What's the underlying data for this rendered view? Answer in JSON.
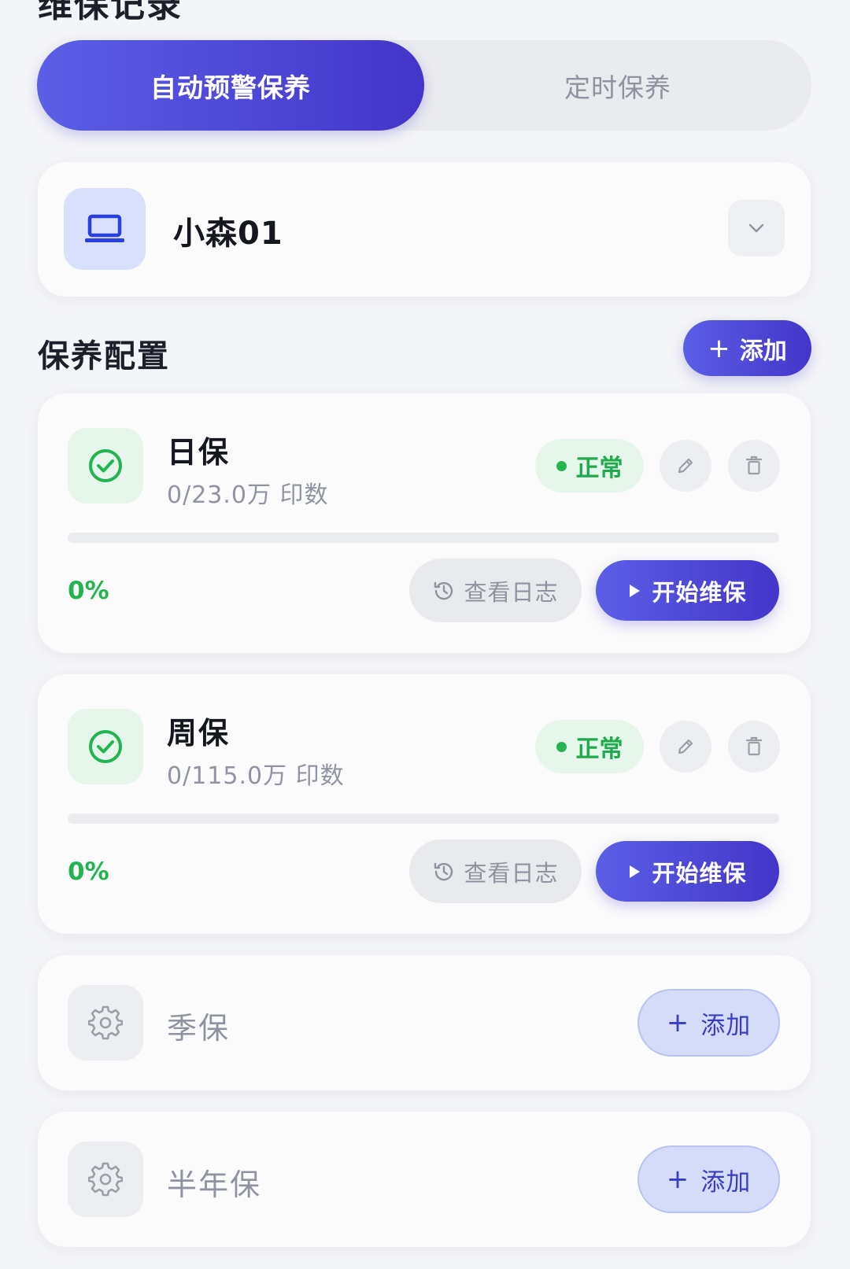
{
  "header": {
    "title": "维保记录"
  },
  "tabs": [
    {
      "label": "自动预警保养",
      "active": true
    },
    {
      "label": "定时保养",
      "active": false
    }
  ],
  "device": {
    "name": "小森01",
    "icon": "laptop-icon"
  },
  "section": {
    "title": "保养配置",
    "add_label": "添加"
  },
  "configs": [
    {
      "title": "日保",
      "subtitle": "0/23.0万 印数",
      "status": "正常",
      "progress_percent": 0,
      "percent_label": "0%",
      "log_label": "查看日志",
      "start_label": "开始维保"
    },
    {
      "title": "周保",
      "subtitle": "0/115.0万 印数",
      "status": "正常",
      "progress_percent": 0,
      "percent_label": "0%",
      "log_label": "查看日志",
      "start_label": "开始维保"
    }
  ],
  "empty_configs": [
    {
      "title": "季保",
      "add_label": "添加"
    },
    {
      "title": "半年保",
      "add_label": "添加"
    }
  ],
  "colors": {
    "accent": "#4f4ddb",
    "success": "#22b451",
    "muted": "#8e93a0"
  }
}
